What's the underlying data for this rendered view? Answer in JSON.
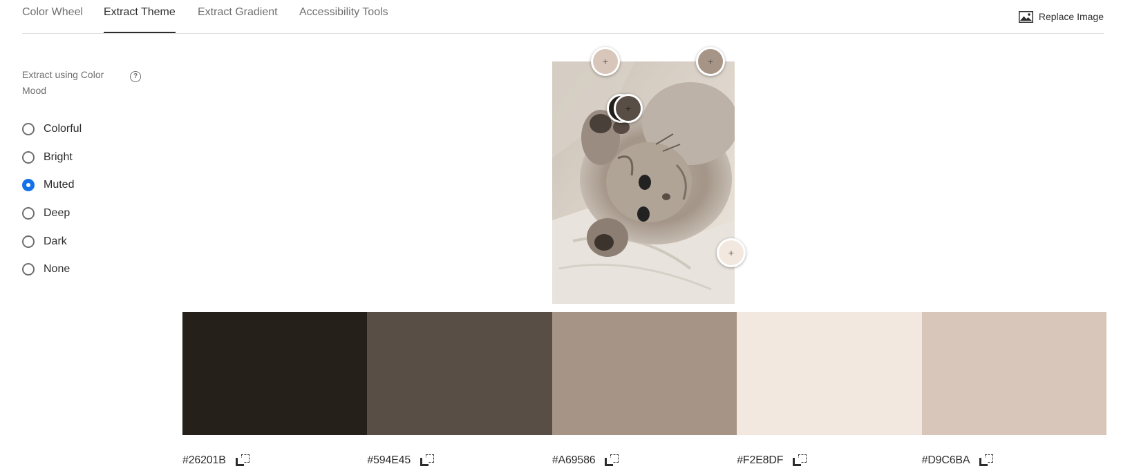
{
  "tabs": [
    {
      "label": "Color Wheel",
      "active": false
    },
    {
      "label": "Extract Theme",
      "active": true
    },
    {
      "label": "Extract Gradient",
      "active": false
    },
    {
      "label": "Accessibility Tools",
      "active": false
    }
  ],
  "toolbar": {
    "replace_label": "Replace Image",
    "replace_icon": "image-icon"
  },
  "sidebar": {
    "title": "Extract using Color Mood",
    "help_icon": "help-icon",
    "help_glyph": "?",
    "options": [
      {
        "label": "Colorful",
        "checked": false
      },
      {
        "label": "Bright",
        "checked": false
      },
      {
        "label": "Muted",
        "checked": true
      },
      {
        "label": "Deep",
        "checked": false
      },
      {
        "label": "Dark",
        "checked": false
      },
      {
        "label": "None",
        "checked": false
      }
    ]
  },
  "picker_glyph": "+",
  "swatches": [
    {
      "hex": "#26201B"
    },
    {
      "hex": "#594E45"
    },
    {
      "hex": "#A69586"
    },
    {
      "hex": "#F2E8DF"
    },
    {
      "hex": "#D9C6BA"
    }
  ]
}
